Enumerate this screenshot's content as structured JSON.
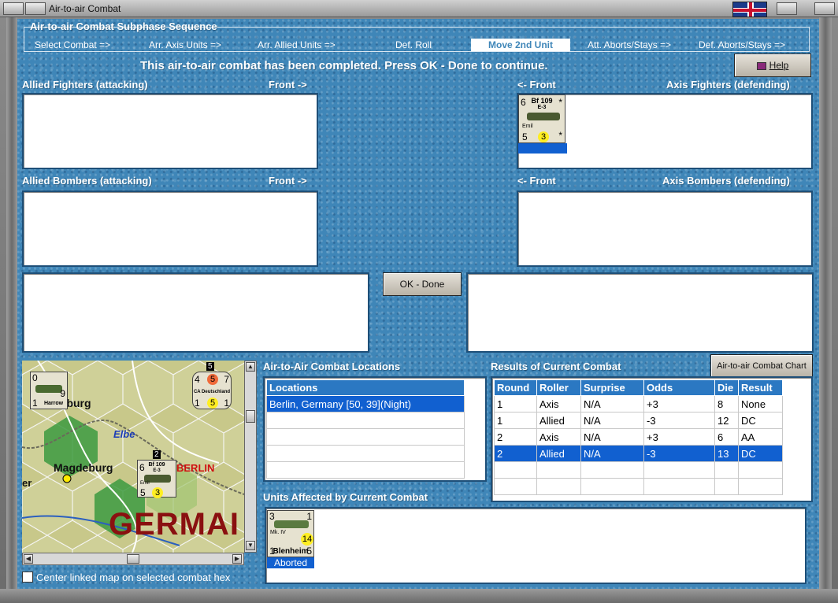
{
  "window": {
    "title": "Air-to-air Combat"
  },
  "sequence": {
    "title": "Air-to-air Combat Subphase Sequence",
    "steps": [
      "Select Combat =>",
      "Arr. Axis Units =>",
      "Arr. Allied Units =>",
      "Def. Roll",
      "Move 2nd Unit",
      "Att. Aborts/Stays =>",
      "Def. Aborts/Stays =>"
    ],
    "active_index": 4
  },
  "message": "This air-to-air combat has been completed.  Press OK - Done to continue.",
  "help_label": "Help",
  "allied_fighters": {
    "label": "Allied Fighters (attacking)",
    "front": "Front ->"
  },
  "axis_fighters": {
    "label": "Axis Fighters (defending)",
    "front": "<- Front"
  },
  "allied_bombers": {
    "label": "Allied Bombers (attacking)",
    "front": "Front ->"
  },
  "axis_bombers": {
    "label": "Axis Bombers (defending)",
    "front": "<- Front"
  },
  "axis_fighter_unit": {
    "left_num": "6",
    "name": "Bf 109",
    "variant": "E-3",
    "sub": "Emil",
    "air": "5",
    "combat": "3",
    "star": "*"
  },
  "ok_label": "OK - Done",
  "map": {
    "city1": "Magdeburg",
    "city2": "BERLIN",
    "city3": "mburg",
    "river": "Elbe",
    "country": "GERMAI",
    "partial": "er",
    "unit_harrow": {
      "top": "0",
      "right": "9",
      "bottom_left": "1",
      "name": "Harrow"
    },
    "unit_ca": {
      "tl": "4",
      "tm": "5",
      "tr": "7",
      "name": "CA Deutschland",
      "bl": "1",
      "bm": "5",
      "br": "1",
      "stack": "5"
    },
    "unit_bf": {
      "top": "2",
      "left": "6",
      "name": "Bf 109",
      "variant": "E-3",
      "sub": "Emil",
      "bl": "5",
      "bm": "3"
    }
  },
  "center_map_label": "Center linked map on selected combat hex",
  "locations": {
    "section_label": "Air-to-Air Combat Locations",
    "header": "Locations",
    "rows": [
      "Berlin, Germany [50, 39](Night)",
      "",
      "",
      "",
      ""
    ]
  },
  "results": {
    "section_label": "Results of Current Combat",
    "chart_button": "Air-to-air Combat Chart",
    "headers": [
      "Round",
      "Roller",
      "Surprise",
      "Odds",
      "Die",
      "Result"
    ],
    "rows": [
      [
        "1",
        "Axis",
        "N/A",
        "+3",
        "8",
        "None"
      ],
      [
        "1",
        "Allied",
        "N/A",
        "-3",
        "12",
        "DC"
      ],
      [
        "2",
        "Axis",
        "N/A",
        "+3",
        "6",
        "AA"
      ],
      [
        "2",
        "Allied",
        "N/A",
        "-3",
        "13",
        "DC"
      ],
      [
        "",
        "",
        "",
        "",
        "",
        ""
      ],
      [
        "",
        "",
        "",
        "",
        "",
        ""
      ]
    ],
    "selected_row": 3
  },
  "affected": {
    "section_label": "Units Affected by Current Combat",
    "unit": {
      "tl": "3",
      "tr": "1",
      "mark": "Mk. IV",
      "name": "Blenheim",
      "bl": "1",
      "br": "5",
      "dot": "14"
    },
    "status": "Aborted"
  }
}
